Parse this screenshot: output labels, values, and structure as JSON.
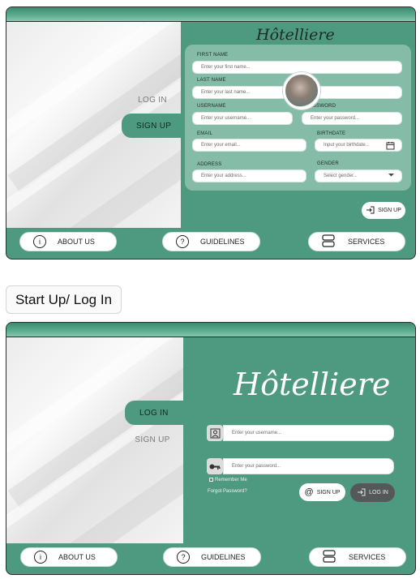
{
  "signup_screen": {
    "brand": "Hôtelliere",
    "tabs": {
      "login": "LOG IN",
      "signup": "SIGN UP"
    },
    "fields": {
      "first_name": {
        "label": "FIRST NAME",
        "placeholder": "Enter your first name..."
      },
      "last_name": {
        "label": "LAST NAME",
        "placeholder": "Enter your last name..."
      },
      "username": {
        "label": "USERNAME",
        "placeholder": "Enter your username..."
      },
      "password": {
        "label": "PASSWORD",
        "placeholder": "Enter your password..."
      },
      "email": {
        "label": "EMAIL",
        "placeholder": "Enter your email..."
      },
      "birthdate": {
        "label": "BIRTHDATE",
        "placeholder": "Input your birthdate..."
      },
      "address": {
        "label": "ADDRESS",
        "placeholder": "Enter your address..."
      },
      "gender": {
        "label": "GENDER",
        "placeholder": "Select gender..."
      }
    },
    "signup_button": "SIGN UP"
  },
  "nav": {
    "about": "ABOUT US",
    "guidelines": "GUIDELINES",
    "services": "SERVICES"
  },
  "section_title": "Start Up/ Log In",
  "login_screen": {
    "brand": "Hôtelliere",
    "tabs": {
      "login": "LOG IN",
      "signup": "SIGN UP"
    },
    "username_placeholder": "Enter your username...",
    "password_placeholder": "Enter your password...",
    "remember_me": "Remember Me",
    "forgot_password": "Forgot Password?",
    "signup_button": "SIGN UP",
    "login_button": "LOG IN"
  },
  "icons": {
    "about": "info-icon",
    "guidelines": "question-icon",
    "services": "services-icon",
    "calendar": "calendar-icon",
    "dropdown": "chevron-down-icon",
    "signin": "sign-in-icon",
    "user": "user-icon",
    "key": "key-icon",
    "at": "at-icon"
  },
  "colors": {
    "green": "#4e9a80",
    "dark_button": "#555858"
  }
}
